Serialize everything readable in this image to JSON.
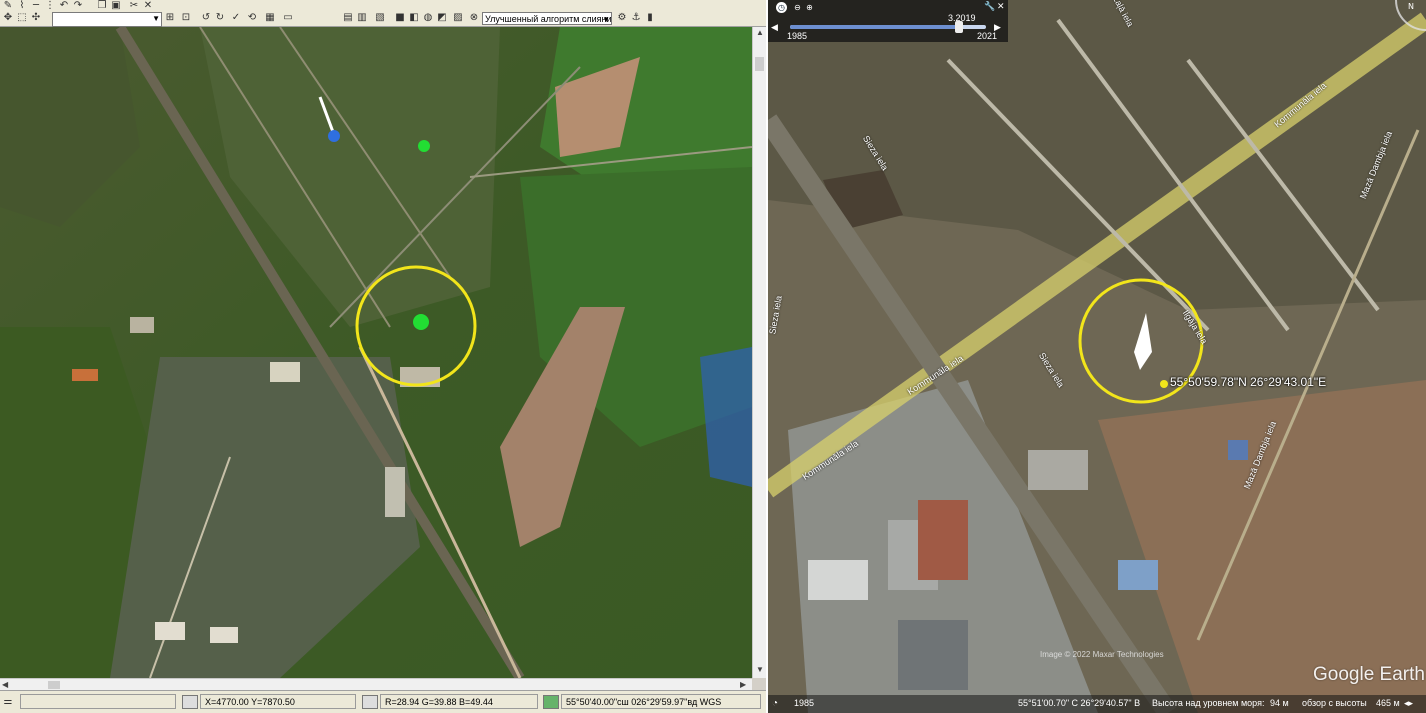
{
  "left_app": {
    "toolbar": {
      "layer_select_value": "",
      "algorithm_select_value": "Улучшенный алгоритм слияни"
    },
    "status": {
      "xy": "X=4770.00 Y=7870.50",
      "rgb": "R=28.94 G=39.88 B=49.44",
      "geo": "55°50'40.00\"сш 026°29'59.97\"вд WGS"
    }
  },
  "google_earth": {
    "timeline": {
      "start_year": "1985",
      "end_year": "2021",
      "current_date": "3.2019",
      "position_fraction": 0.86
    },
    "placemark_coords": "55°50'59.78\"N  26°29'43.01\"E",
    "street_labels": [
      "Kommunāla iela",
      "Kommunāla iela",
      "Sieza iela",
      "Sieza iela",
      "Ilgāja iela",
      "Ilgāja iela",
      "Mazā Dambja iela",
      "Mazā Dambja iela",
      "Sieza iela",
      "Zaļā iela",
      "Ilgāja iela"
    ],
    "copyright": "Image © 2022 Maxar Technologies",
    "logo": "Google Earth",
    "compass_letter": "N",
    "status": {
      "year": "1985",
      "coords": "55°51'00.70\" С  26°29'40.57\" В",
      "altitude_label": "Высота над уровнем моря:",
      "altitude_value": "94 м",
      "eye_label": "обзор с высоты",
      "eye_value": "465 м"
    }
  },
  "colors": {
    "highlight_circle": "#f2e51b",
    "toolbar_bg": "#ece9d8"
  }
}
